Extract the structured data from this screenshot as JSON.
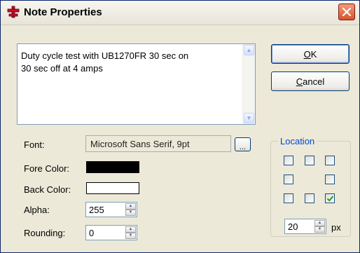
{
  "window": {
    "title": "Note Properties",
    "app_icon": "red-cross-icon",
    "close_icon": "close-icon"
  },
  "note": {
    "text": "Duty cycle test with UB1270FR 30 sec on\n30 sec off at 4 amps"
  },
  "buttons": {
    "ok_mnemonic": "O",
    "ok_rest": "K",
    "cancel_mnemonic": "C",
    "cancel_rest": "ancel",
    "browse_label": "..."
  },
  "fields": {
    "font_label": "Font:",
    "font_value": "Microsoft Sans Serif, 9pt",
    "fore_color_label": "Fore Color:",
    "fore_color": "#000000",
    "back_color_label": "Back Color:",
    "back_color": "#ffffff",
    "alpha_label": "Alpha:",
    "alpha_value": "255",
    "rounding_label": "Rounding:",
    "rounding_value": "0"
  },
  "location": {
    "title": "Location",
    "checkboxes": [
      {
        "name": "top-left",
        "checked": false
      },
      {
        "name": "top-center",
        "checked": false
      },
      {
        "name": "top-right",
        "checked": false
      },
      {
        "name": "middle-left",
        "checked": false
      },
      {
        "name": "middle-right",
        "checked": false
      },
      {
        "name": "bottom-left",
        "checked": false
      },
      {
        "name": "bottom-center",
        "checked": false
      },
      {
        "name": "bottom-right",
        "checked": true
      }
    ],
    "offset_value": "20",
    "offset_unit": "px"
  },
  "colors": {
    "accent": "#0046d5",
    "check_mark": "#21a121",
    "close_button": "#d8532c"
  }
}
